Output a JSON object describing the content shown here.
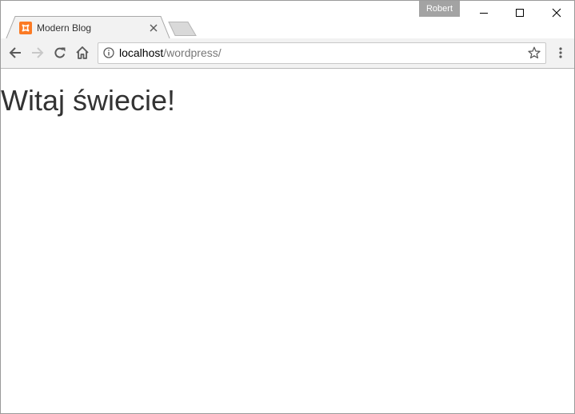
{
  "window": {
    "profile_name": "Robert",
    "controls": {
      "minimize_icon": "minimize-icon",
      "maximize_icon": "maximize-icon",
      "close_icon": "close-icon"
    }
  },
  "tabs": [
    {
      "title": "Modern Blog",
      "favicon": "xampp-favicon",
      "active": true
    }
  ],
  "toolbar": {
    "back_icon": "arrow-left-icon",
    "forward_icon": "arrow-right-icon",
    "reload_icon": "reload-icon",
    "home_icon": "home-icon",
    "menu_icon": "kebab-menu-icon",
    "address": {
      "host": "localhost",
      "path": "/wordpress/",
      "security_icon": "info-icon",
      "bookmark_icon": "star-icon"
    }
  },
  "page": {
    "heading": "Witaj świecie!"
  },
  "colors": {
    "toolbar_bg": "#f2f2f2",
    "profile_badge": "#a3a3a3",
    "favicon": "#fb7a24",
    "heading_text": "#333333"
  }
}
